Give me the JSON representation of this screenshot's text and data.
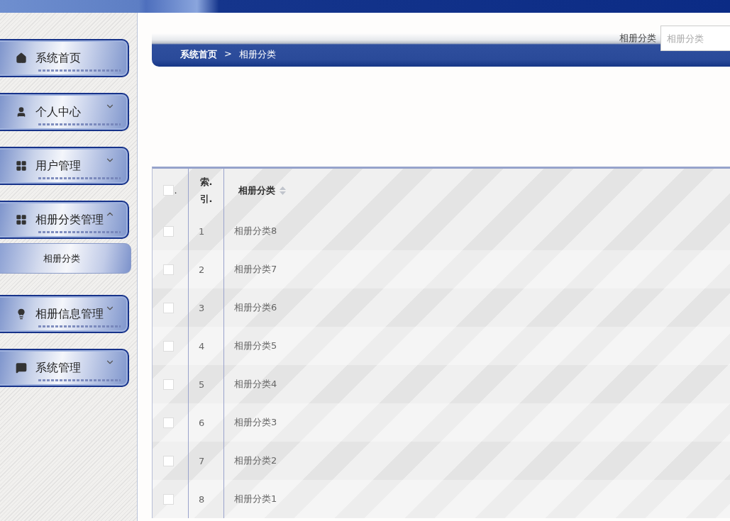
{
  "sidebar": {
    "items": [
      {
        "label": "系统首页",
        "kind": "link"
      },
      {
        "label": "个人中心",
        "kind": "submenu",
        "expanded": false
      },
      {
        "label": "用户管理",
        "kind": "submenu",
        "expanded": false
      },
      {
        "label": "相册分类管理",
        "kind": "submenu",
        "expanded": true,
        "children": [
          {
            "label": "相册分类"
          }
        ]
      },
      {
        "label": "相册信息管理",
        "kind": "submenu",
        "expanded": false
      },
      {
        "label": "系统管理",
        "kind": "submenu",
        "expanded": false
      }
    ]
  },
  "breadcrumb": [
    "系统首页",
    "相册分类"
  ],
  "breadcrumb_separator": ">",
  "search": {
    "label": "相册分类",
    "placeholder": "相册分类"
  },
  "table": {
    "select_all": {
      "label": ".",
      "checked": false
    },
    "columns": [
      {
        "label": "索.引."
      },
      {
        "label": "相册分类",
        "sortable": true
      }
    ],
    "rows": [
      {
        "checked": false,
        "cells": [
          "1",
          "相册分类8"
        ]
      },
      {
        "checked": false,
        "cells": [
          "2",
          "相册分类7"
        ]
      },
      {
        "checked": false,
        "cells": [
          "3",
          "相册分类6"
        ]
      },
      {
        "checked": false,
        "cells": [
          "4",
          "相册分类5"
        ]
      },
      {
        "checked": false,
        "cells": [
          "5",
          "相册分类4"
        ]
      },
      {
        "checked": false,
        "cells": [
          "6",
          "相册分类3"
        ]
      },
      {
        "checked": false,
        "cells": [
          "7",
          "相册分类2"
        ]
      },
      {
        "checked": false,
        "cells": [
          "8",
          "相册分类1"
        ]
      }
    ]
  }
}
